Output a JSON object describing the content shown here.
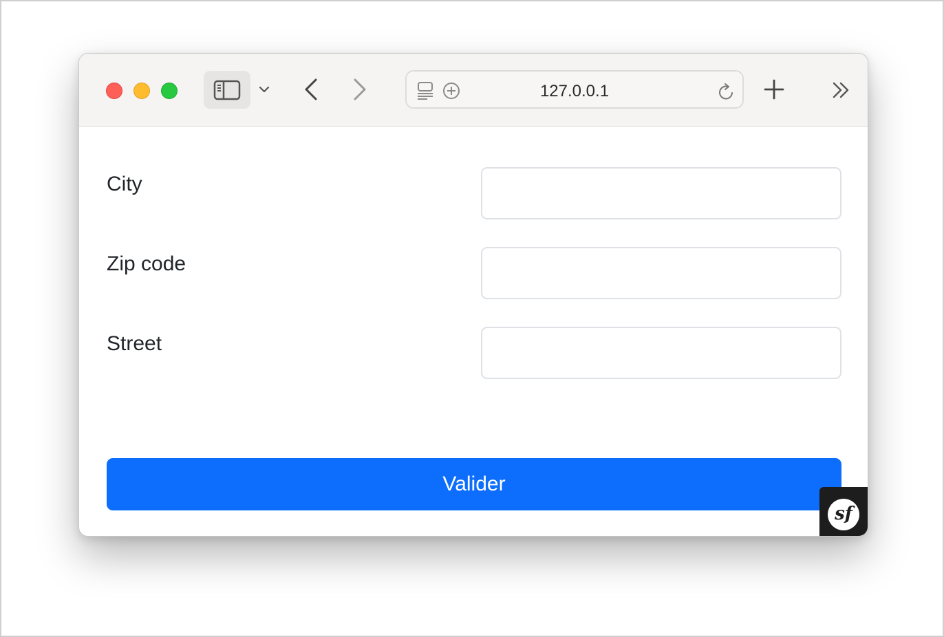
{
  "browser": {
    "url": "127.0.0.1",
    "icons": [
      "sidebar-icon",
      "chevron-down-icon",
      "back-icon",
      "forward-icon",
      "reader-icon",
      "privacy-icon",
      "reload-icon",
      "new-tab-icon",
      "more-icon"
    ]
  },
  "form": {
    "fields": [
      {
        "label": "City",
        "value": ""
      },
      {
        "label": "Zip code",
        "value": ""
      },
      {
        "label": "Street",
        "value": ""
      }
    ],
    "submit_label": "Valider"
  },
  "debug_toolbar": {
    "logo_text": "sf"
  },
  "colors": {
    "accent": "#0d6efd",
    "close": "#fe5f57",
    "minimize": "#febc2e",
    "zoom": "#28c840"
  }
}
